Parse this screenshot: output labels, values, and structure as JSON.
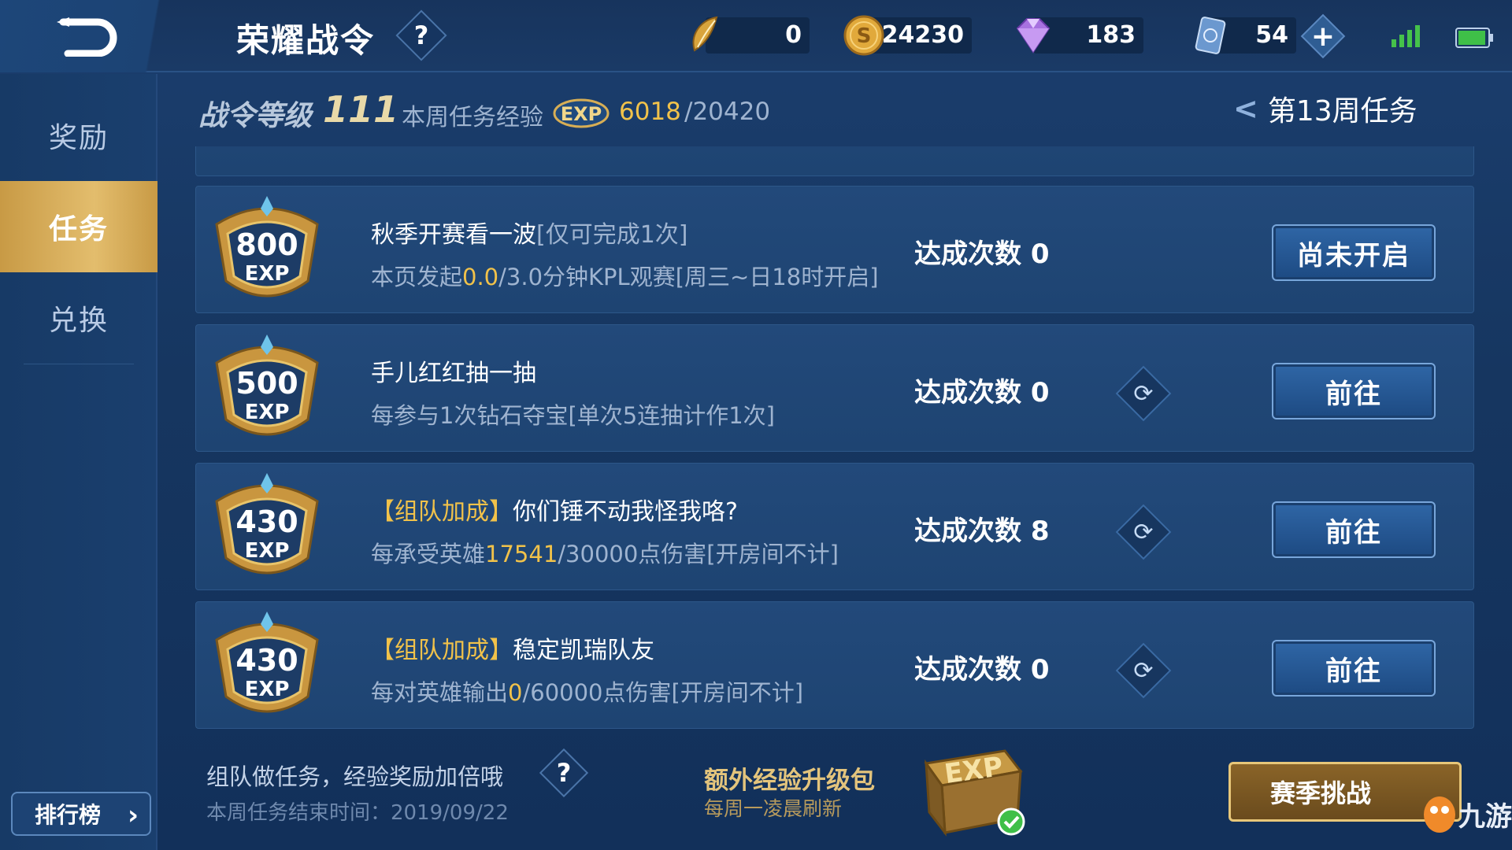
{
  "header": {
    "title": "荣耀战令",
    "help_icon_glyph": "?",
    "back_icon": "back-arrow-icon"
  },
  "currencies": [
    {
      "name": "token",
      "icon": "feather-token-icon",
      "value": "0"
    },
    {
      "name": "gold",
      "icon": "gold-coin-icon",
      "value": "24230"
    },
    {
      "name": "diamond",
      "icon": "diamond-icon",
      "value": "183"
    },
    {
      "name": "ticket",
      "icon": "ticket-card-icon",
      "value": "54"
    }
  ],
  "plus_glyph": "+",
  "status": {
    "signal_icon": "signal-icon",
    "battery_icon": "battery-icon"
  },
  "sidebar": {
    "items": [
      {
        "label": "奖励",
        "active": false
      },
      {
        "label": "任务",
        "active": true
      },
      {
        "label": "兑换",
        "active": false
      }
    ],
    "ranking_label": "排行榜",
    "ranking_arrow": "›"
  },
  "level_bar": {
    "level_label": "战令等级",
    "level": "111",
    "weekly_exp_label": "本周任务经验",
    "exp_current": "6018",
    "exp_total": "/20420",
    "week_label": "第13周任务",
    "week_chevron": "<"
  },
  "tasks": [
    {
      "exp": "800",
      "exp_unit": "EXP",
      "title": "秋季开赛看一波",
      "title_note": "[仅可完成1次]",
      "tag": "",
      "desc_prefix": "本页发起",
      "desc_current": "0.0",
      "desc_suffix": "/3.0分钟KPL观赛[周三~日18时开启]",
      "count_label": "达成次数",
      "count": "0",
      "has_refresh": false,
      "button": "尚未开启"
    },
    {
      "exp": "500",
      "exp_unit": "EXP",
      "title": "手儿红红抽一抽",
      "title_note": "",
      "tag": "",
      "desc_prefix": "每参与1次钻石夺宝[单次5连抽计作1次]",
      "desc_current": "",
      "desc_suffix": "",
      "count_label": "达成次数",
      "count": "0",
      "has_refresh": true,
      "button": "前往"
    },
    {
      "exp": "430",
      "exp_unit": "EXP",
      "title": "你们锤不动我怪我咯?",
      "title_note": "",
      "tag": "【组队加成】",
      "desc_prefix": "每承受英雄",
      "desc_current": "17541",
      "desc_suffix": "/30000点伤害[开房间不计]",
      "count_label": "达成次数",
      "count": "8",
      "has_refresh": true,
      "button": "前往"
    },
    {
      "exp": "430",
      "exp_unit": "EXP",
      "title": "稳定凯瑞队友",
      "title_note": "",
      "tag": "【组队加成】",
      "desc_prefix": "每对英雄输出",
      "desc_current": "0",
      "desc_suffix": "/60000点伤害[开房间不计]",
      "count_label": "达成次数",
      "count": "0",
      "has_refresh": true,
      "button": "前往"
    }
  ],
  "footer": {
    "tip": "组队做任务，经验奖励加倍哦",
    "help_glyph": "?",
    "end_time": "本周任务结束时间：2019/09/22",
    "package_title": "额外经验升级包",
    "package_sub": "每周一凌晨刷新",
    "package_icon": "exp-chest-icon",
    "season_button": "赛季挑战",
    "watermark": "九游"
  },
  "colors": {
    "background": "#163660",
    "card": "#22497a",
    "accent_gold": "#f1c24a",
    "muted_text": "#9fb4d0",
    "active_tab": "#d8b060"
  }
}
